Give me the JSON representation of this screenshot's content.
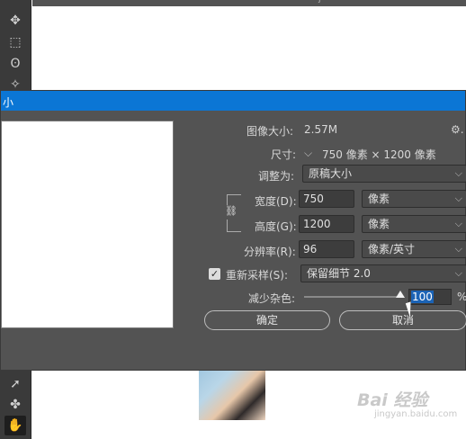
{
  "window": {
    "title_fragment": "小",
    "top_fragment": "j"
  },
  "toolbar": {
    "tools": [
      {
        "icon": "move-tool-icon",
        "glyph": "✥"
      },
      {
        "icon": "marquee-tool-icon",
        "glyph": "⬚"
      },
      {
        "icon": "lasso-tool-icon",
        "glyph": "ʘ"
      },
      {
        "icon": "magic-wand-tool-icon",
        "glyph": "✧"
      },
      {
        "icon": "path-selection-tool-icon",
        "glyph": "➚"
      },
      {
        "icon": "custom-shape-tool-icon",
        "glyph": "✤"
      },
      {
        "icon": "hand-tool-icon",
        "glyph": "✋"
      }
    ]
  },
  "dialog": {
    "image_size_label": "图像大小:",
    "image_size_value": "2.57M",
    "dimensions_label": "尺寸:",
    "dimensions_value": "750 像素 × 1200 像素",
    "fit_to_label": "调整为:",
    "fit_to_value": "原稿大小",
    "width_label": "宽度(D):",
    "width_value": "750",
    "width_unit": "像素",
    "height_label": "高度(G):",
    "height_value": "1200",
    "height_unit": "像素",
    "resolution_label": "分辨率(R):",
    "resolution_value": "96",
    "resolution_unit": "像素/英寸",
    "resample_label": "重新采样(S):",
    "resample_value": "保留细节 2.0",
    "reduce_noise_label": "减少杂色:",
    "reduce_noise_value": "100",
    "reduce_noise_unit": "%",
    "reduce_noise_fraction": 0.93,
    "ok_label": "确定",
    "cancel_label": "取消"
  },
  "watermark": {
    "text": "Bai 经验",
    "sub": "jingyan.baidu.com"
  },
  "colors": {
    "titlebar": "#0b76d5",
    "dialog_bg": "#535353",
    "selection": "#1b63b5"
  }
}
